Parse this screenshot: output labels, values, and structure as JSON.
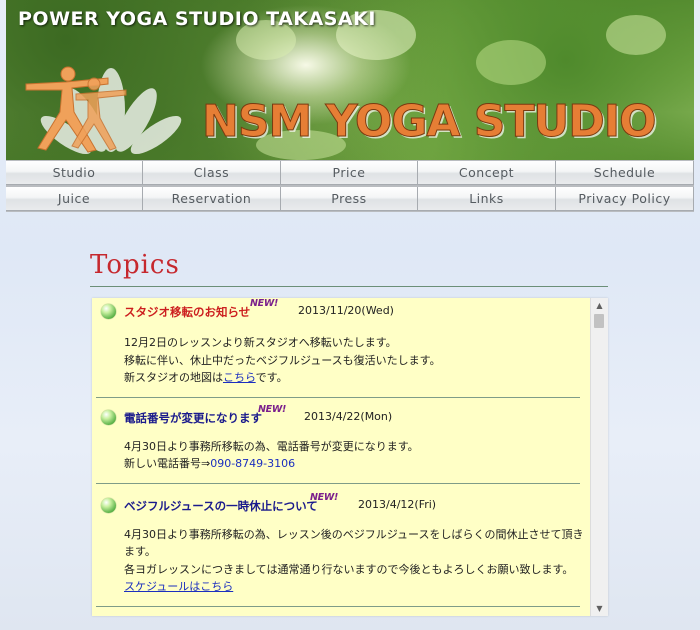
{
  "header": {
    "site_name": "POWER YOGA STUDIO TAKASAKI",
    "logo_text": "NSM YOGA STUDIO"
  },
  "nav": {
    "row1": [
      "Studio",
      "Class",
      "Price",
      "Concept",
      "Schedule"
    ],
    "row2": [
      "Juice",
      "Reservation",
      "Press",
      "Links",
      "Privacy Policy"
    ]
  },
  "topics": {
    "heading": "Topics",
    "items": [
      {
        "title": "スタジオ移転のお知らせ",
        "title_color": "#cc1f1f",
        "new_badge": "NEW!",
        "date": "2013/11/20(Wed)",
        "lines": [
          "12月2日のレッスンより新スタジオへ移転いたします。",
          "移転に伴い、休止中だったベジフルジュースも復活いたします。"
        ],
        "map_prefix": "新スタジオの地図は",
        "map_link": "こちら",
        "map_suffix": "です。"
      },
      {
        "title": "電話番号が変更になります",
        "title_color": "#1a1a8c",
        "new_badge": "NEW!",
        "date": "2013/4/22(Mon)",
        "lines": [
          "4月30日より事務所移転の為、電話番号が変更になります。"
        ],
        "phone_prefix": "新しい電話番号⇒",
        "phone": "090-8749-3106"
      },
      {
        "title": "ベジフルジュースの一時休止について",
        "title_color": "#1a1a8c",
        "new_badge": "NEW!",
        "date": "2013/4/12(Fri)",
        "lines": [
          "4月30日より事務所移転の為、レッスン後のベジフルジュースをしばらくの間休止させて頂きます。",
          "各ヨガレッスンにつきましては通常通り行ないますので今後ともよろしくお願い致します。"
        ],
        "link": "スケジュールはこちら"
      }
    ]
  },
  "scrollbar": {
    "up_icon": "▲",
    "down_icon": "▼"
  },
  "colors": {
    "accent": "#c6282e",
    "topics_bg": "#ffffc6",
    "link": "#1b2fbf"
  }
}
